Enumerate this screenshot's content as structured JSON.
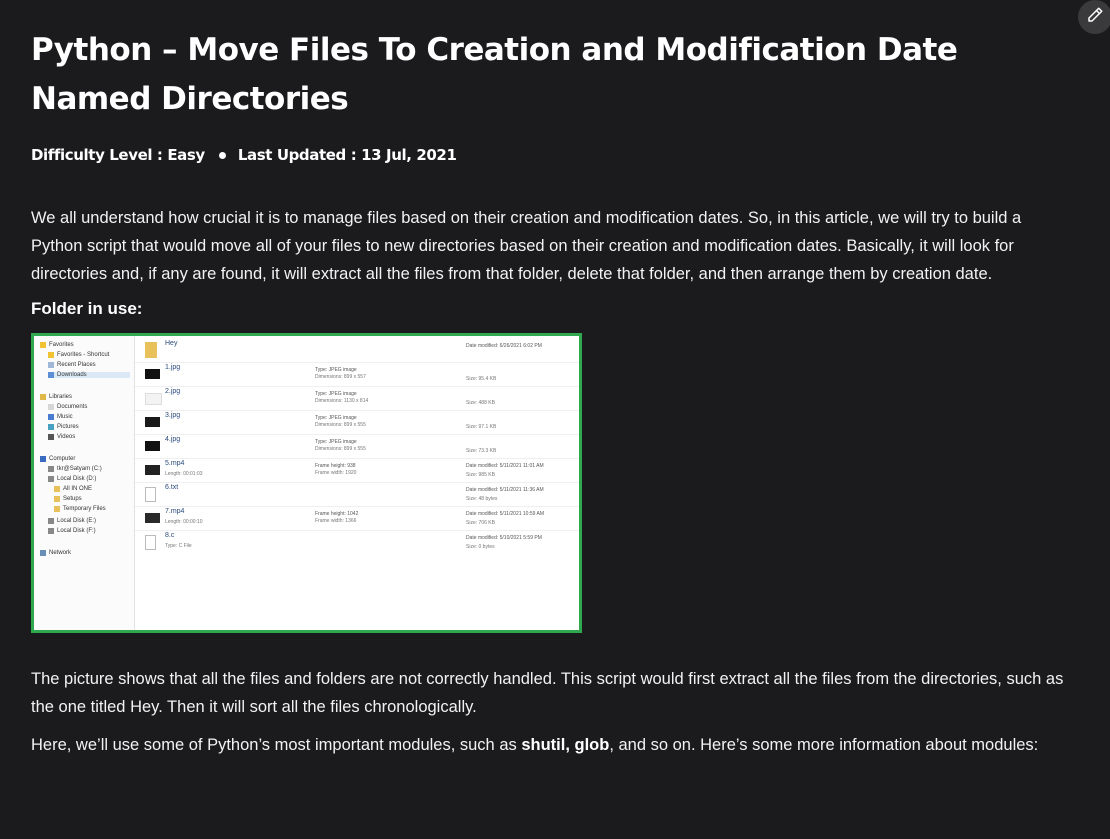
{
  "edit_button": {
    "icon": "pencil-icon"
  },
  "article": {
    "title": "Python – Move Files To Creation and Modification Date Named Directories",
    "difficulty": "Difficulty Level : Easy",
    "last_updated": "Last Updated : 13 Jul, 2021",
    "intro": "We all understand how crucial it is to manage files based on their creation and modification dates. So, in this article, we will try to build a Python script that would move all of your files to new directories based on their creation and modification dates. Basically, it will look for directories and, if any are found, it will extract all the files from that folder, delete that folder, and then arrange them by creation date.",
    "folder_heading": "Folder in use:",
    "para2": "The picture shows that all the files and folders are not correctly handled. This script would first extract all the files from the directories, such as the one titled Hey. Then it will sort all the files chronologically.",
    "para3_start": "Here, we’ll use some of Python’s most important modules, such as ",
    "para3_bold1": "shutil",
    "para3_sep": ", ",
    "para3_bold2": "glob",
    "para3_end": ", and so on. Here’s some more information about modules:"
  },
  "screenshot": {
    "nav": [
      "Favorites",
      "Favorites - Shortcut",
      "Recent Places",
      "Downloads",
      "Libraries",
      "Documents",
      "Music",
      "Pictures",
      "Videos",
      "Computer",
      "tkr@Satyam (C:)",
      "Local Disk (D:)",
      "All IN ONE",
      "Setups",
      "Temporary Files",
      "Local Disk (E:)",
      "Local Disk (F:)",
      "Network"
    ],
    "files": [
      {
        "name": "Hey",
        "sub": "",
        "m1": "",
        "m2": "",
        "r1": "Date modified: 6/26/2021 6:02 PM",
        "r2": ""
      },
      {
        "name": "1.jpg",
        "sub": "",
        "m1": "Type: JPEG image",
        "m2": "Dimensions: 899 x 557",
        "r1": "",
        "r2": "Size: 95.4 KB"
      },
      {
        "name": "2.jpg",
        "sub": "",
        "m1": "Type: JPEG image",
        "m2": "Dimensions: 1130 x 814",
        "r1": "",
        "r2": "Size: 488 KB"
      },
      {
        "name": "3.jpg",
        "sub": "",
        "m1": "Type: JPEG image",
        "m2": "Dimensions: 899 x 555",
        "r1": "",
        "r2": "Size: 97.1 KB"
      },
      {
        "name": "4.jpg",
        "sub": "",
        "m1": "Type: JPEG image",
        "m2": "Dimensions: 899 x 555",
        "r1": "",
        "r2": "Size: 73.3 KB"
      },
      {
        "name": "5.mp4",
        "sub": "Length: 00:01:03",
        "m1": "Frame height: 938",
        "m2": "Frame width: 1920",
        "r1": "Date modified: 5/11/2021 11:01 AM",
        "r2": "Size: 985 KB"
      },
      {
        "name": "6.txt",
        "sub": "",
        "m1": "",
        "m2": "",
        "r1": "Date modified: 5/11/2021 11:36 AM",
        "r2": "Size: 48 bytes"
      },
      {
        "name": "7.mp4",
        "sub": "Length: 00:00:10",
        "m1": "Frame height: 1042",
        "m2": "Frame width: 1366",
        "r1": "Date modified: 5/11/2021 10:59 AM",
        "r2": "Size: 706 KB"
      },
      {
        "name": "8.c",
        "sub": "Type: C File",
        "m1": "",
        "m2": "",
        "r1": "Date modified: 5/10/2021 5:59 PM",
        "r2": "Size: 0 bytes"
      }
    ]
  },
  "colors": {
    "background": "#1b1b1e",
    "frame_border": "#2fa84f"
  }
}
